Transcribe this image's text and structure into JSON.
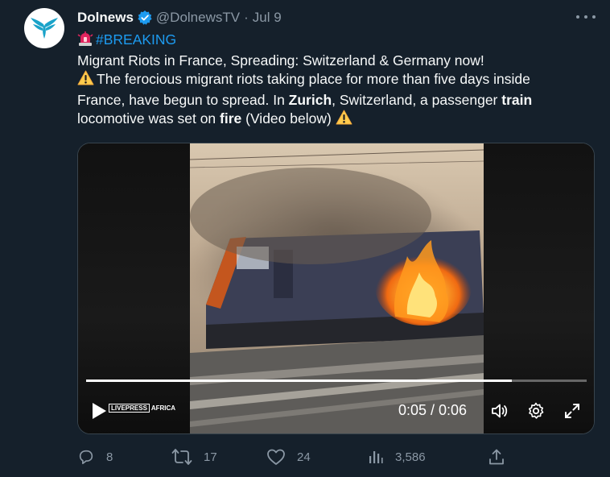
{
  "tweet": {
    "author_name": "Dolnews",
    "handle": "@DolnewsTV",
    "separator": "·",
    "date": "Jul 9",
    "lines": {
      "hashtag": "#BREAKING",
      "line2": "Migrant Riots in France, Spreading: Switzerland & Germany now!",
      "line3": "The ferocious migrant riots taking place for more than five days inside",
      "line4_a": "France, have begun to spread.  In ",
      "line4_b": "Zurich",
      "line4_c": ", Switzerland, a passenger ",
      "line4_d": "train",
      "line5_a": "locomotive was set on ",
      "line5_b": "fire",
      "line5_c": " (Video below) "
    }
  },
  "video": {
    "time_display": "0:05 / 0:06",
    "progress_fraction": 0.85,
    "watermark_brand": "LIVEPRESS",
    "watermark_region": "AFRICA"
  },
  "actions": {
    "replies": "8",
    "retweets": "17",
    "likes": "24",
    "views": "3,586"
  },
  "colors": {
    "background": "#15202b",
    "accent": "#1d9bf0",
    "muted": "#8b98a5"
  },
  "icons": [
    "verified-badge-icon",
    "more-icon",
    "siren-emoji-icon",
    "warning-emoji-icon",
    "play-icon",
    "volume-icon",
    "settings-icon",
    "fullscreen-icon",
    "reply-icon",
    "retweet-icon",
    "like-icon",
    "views-icon",
    "share-icon"
  ]
}
